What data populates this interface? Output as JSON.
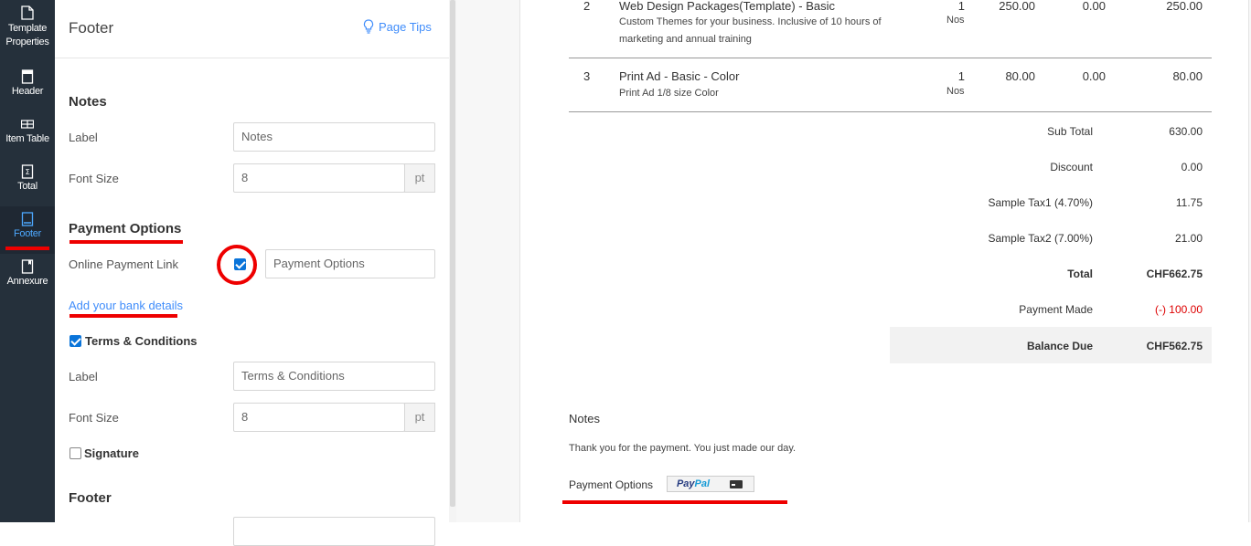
{
  "rail": {
    "items": [
      {
        "label_line1": "Template",
        "label_line2": "Properties",
        "icon": "document-icon"
      },
      {
        "label_line1": "Header",
        "icon": "header-icon"
      },
      {
        "label_line1": "Item Table",
        "icon": "table-icon"
      },
      {
        "label_line1": "Total",
        "icon": "sigma-icon"
      },
      {
        "label_line1": "Footer",
        "icon": "footer-icon",
        "active": true
      },
      {
        "label_line1": "Annexure",
        "icon": "annexure-icon"
      }
    ]
  },
  "panel": {
    "title": "Footer",
    "page_tips": "Page Tips",
    "notes": {
      "section_title": "Notes",
      "label_label": "Label",
      "label_value": "Notes",
      "font_size_label": "Font Size",
      "font_size_value": "8",
      "unit": "pt"
    },
    "payment_options": {
      "section_title": "Payment Options",
      "online_payment_label": "Online Payment Link",
      "online_payment_checked": true,
      "online_payment_value": "Payment Options",
      "bank_link": "Add your bank details"
    },
    "terms": {
      "checkbox_label": "Terms & Conditions",
      "checked": true,
      "label_label": "Label",
      "label_value": "Terms & Conditions",
      "font_size_label": "Font Size",
      "font_size_value": "8",
      "unit": "pt"
    },
    "signature": {
      "checkbox_label": "Signature",
      "checked": false
    },
    "footer_section_title": "Footer"
  },
  "preview": {
    "items": [
      {
        "no": "2",
        "name": "Web Design Packages(Template) - Basic",
        "desc_line1": "Custom Themes for your business. Inclusive of 10 hours of",
        "desc_line2": "marketing and annual training",
        "qty": "1",
        "unit": "Nos",
        "rate": "250.00",
        "discount": "0.00",
        "amount": "250.00"
      },
      {
        "no": "3",
        "name": "Print Ad - Basic - Color",
        "desc_line1": "Print Ad 1/8 size Color",
        "qty": "1",
        "unit": "Nos",
        "rate": "80.00",
        "discount": "0.00",
        "amount": "80.00"
      }
    ],
    "totals": {
      "sub_total_label": "Sub Total",
      "sub_total": "630.00",
      "discount_label": "Discount",
      "discount": "0.00",
      "tax1_label": "Sample Tax1 (4.70%)",
      "tax1": "11.75",
      "tax2_label": "Sample Tax2 (7.00%)",
      "tax2": "21.00",
      "total_label": "Total",
      "total": "CHF662.75",
      "payment_made_label": "Payment Made",
      "payment_made": "(-) 100.00",
      "balance_due_label": "Balance Due",
      "balance_due": "CHF562.75"
    },
    "notes_title": "Notes",
    "notes_text": "Thank you for the payment. You just made our day.",
    "payment_options_label": "Payment Options",
    "paypal_pay": "Pay",
    "paypal_pal": "Pal"
  },
  "colors": {
    "accent": "#408dfb",
    "highlight": "#ee0000",
    "rail_bg": "#25303b"
  }
}
